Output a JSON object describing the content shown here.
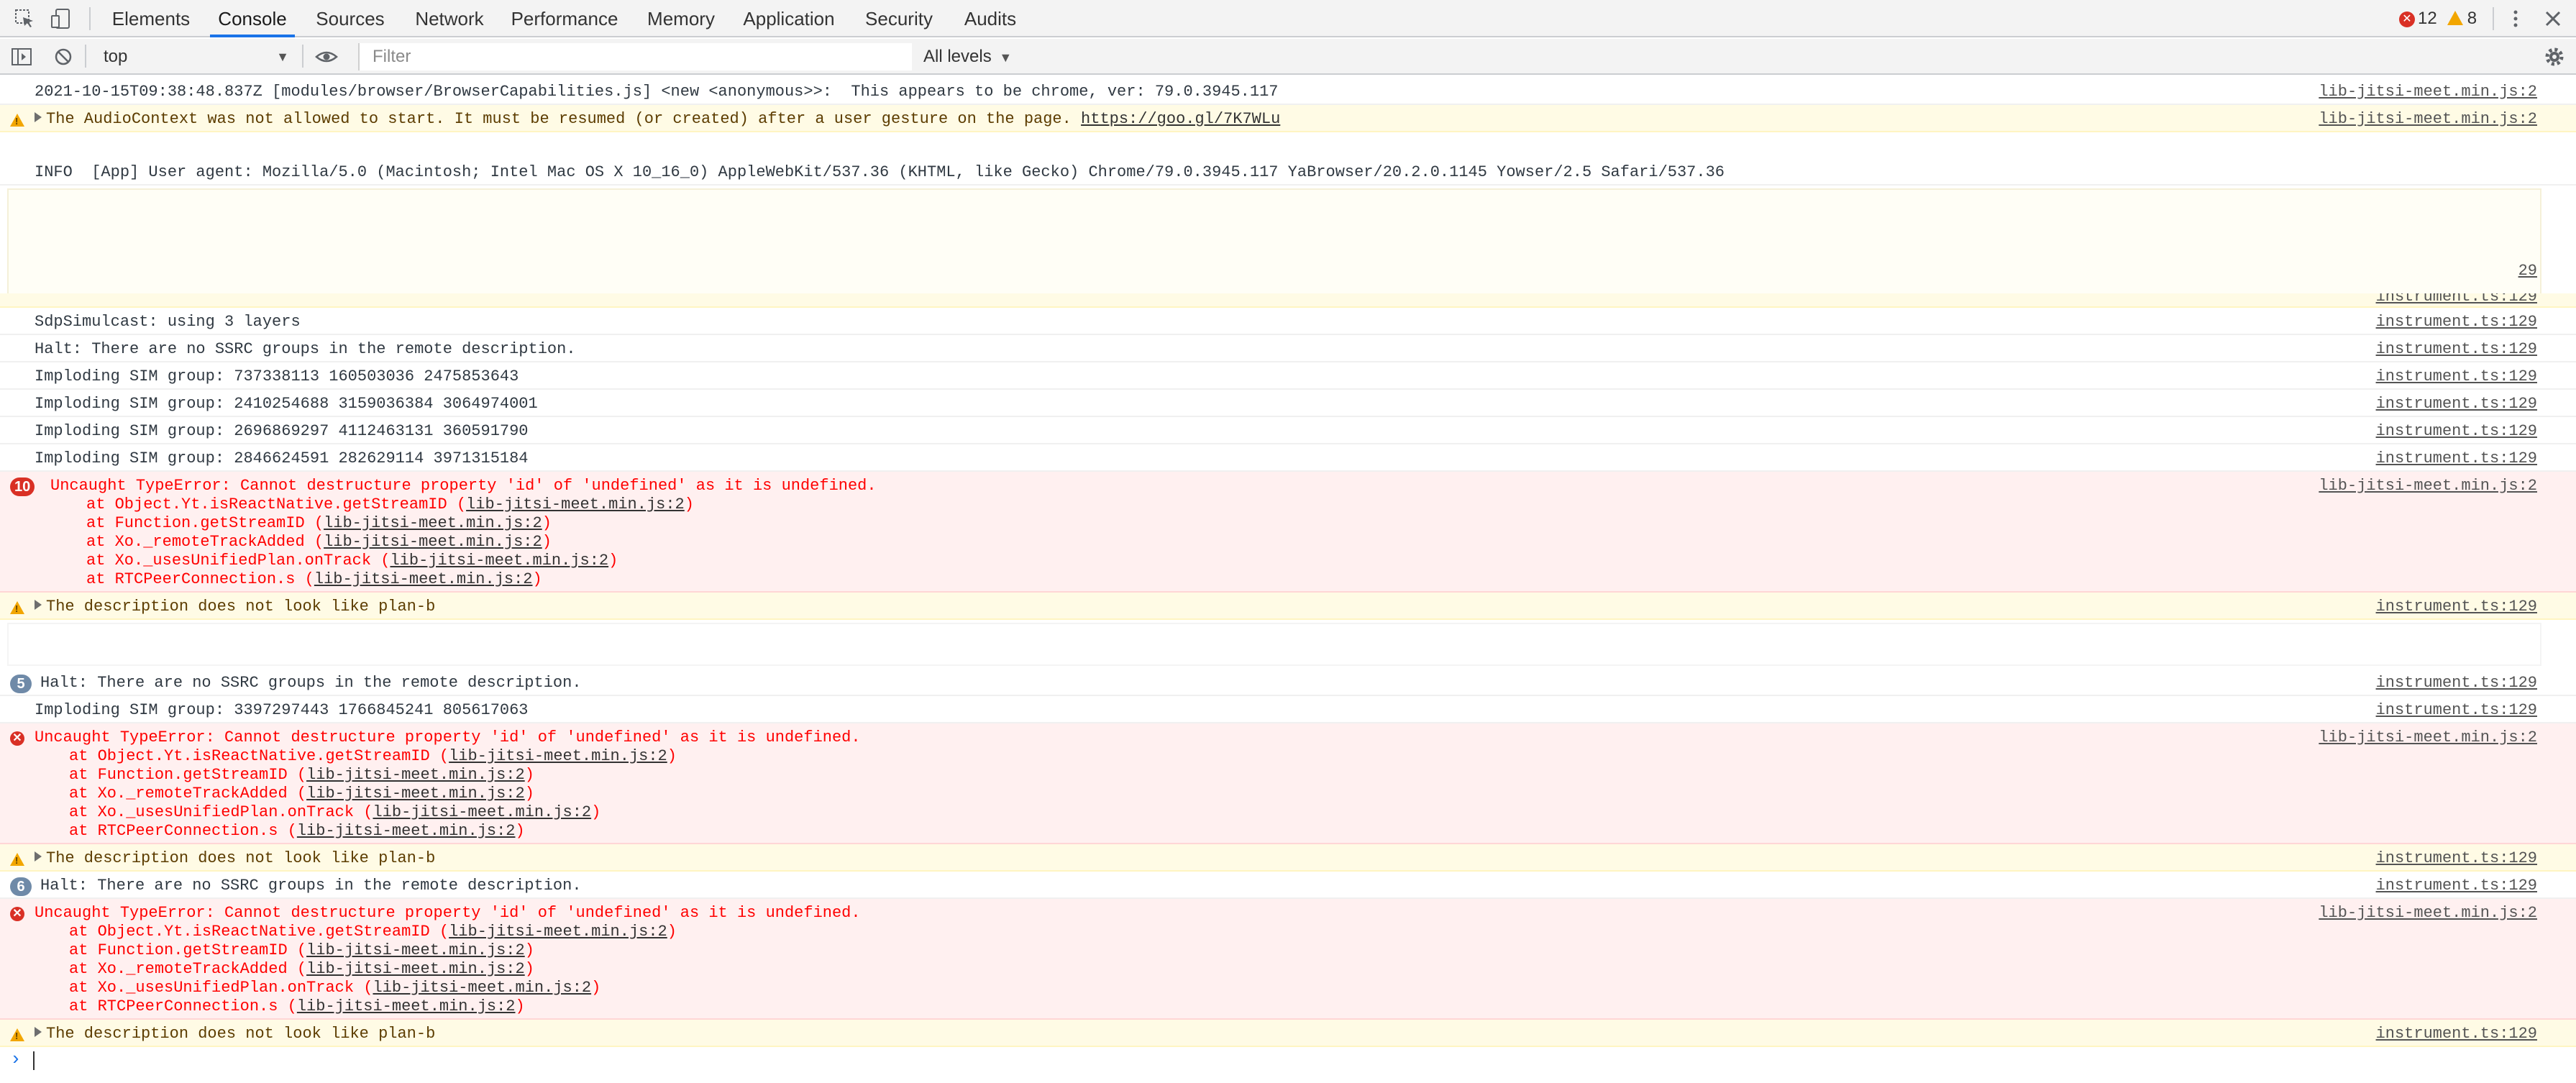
{
  "tabs": [
    {
      "label": "Elements"
    },
    {
      "label": "Console"
    },
    {
      "label": "Sources"
    },
    {
      "label": "Network"
    },
    {
      "label": "Performance"
    },
    {
      "label": "Memory"
    },
    {
      "label": "Application"
    },
    {
      "label": "Security"
    },
    {
      "label": "Audits"
    }
  ],
  "active_tab": "Console",
  "counts": {
    "errors": "12",
    "warnings": "8"
  },
  "toolbar": {
    "context": "top",
    "filter_placeholder": "Filter",
    "levels": "All levels"
  },
  "colors": {
    "error": "#d93025",
    "warning": "#f2a600",
    "accent": "#1a73e8"
  },
  "messages": {
    "m1": {
      "text": "2021-10-15T09:38:48.837Z [modules/browser/BrowserCapabilities.js] <new <anonymous>>:  This appears to be chrome, ver: 79.0.3945.117",
      "src": "lib-jitsi-meet.min.js:2"
    },
    "m2": {
      "text": "The AudioContext was not allowed to start. It must be resumed (or created) after a user gesture on the page. ",
      "link": "https://goo.gl/7K7WLu",
      "src": "lib-jitsi-meet.min.js:2"
    },
    "m3": {
      "text": "INFO  [App] User agent: Mozilla/5.0 (Macintosh; Intel Mac OS X 10_16_0) AppleWebKit/537.36 (KHTML, like Gecko) Chrome/79.0.3945.117 YaBrowser/20.2.0.1145 Yowser/2.5 Safari/537.36"
    },
    "m4": {
      "src_partial": "29"
    },
    "m5": {
      "src": "instrument.ts:129"
    },
    "m6": {
      "text": "SdpSimulcast: using 3 layers",
      "src": "instrument.ts:129"
    },
    "m7": {
      "text": "Halt: There are no SSRC groups in the remote description.",
      "src": "instrument.ts:129"
    },
    "m8": {
      "text": "Imploding SIM group: 737338113 160503036 2475853643",
      "src": "instrument.ts:129"
    },
    "m9": {
      "text": "Imploding SIM group: 2410254688 3159036384 3064974001",
      "src": "instrument.ts:129"
    },
    "m10": {
      "text": "Imploding SIM group: 2696869297 4112463131 360591790",
      "src": "instrument.ts:129"
    },
    "m11": {
      "text": "Imploding SIM group: 2846624591 282629114 3971315184",
      "src": "instrument.ts:129"
    },
    "e1": {
      "count": "10",
      "text": "Uncaught TypeError: Cannot destructure property 'id' of 'undefined' as it is undefined.",
      "src": "lib-jitsi-meet.min.js:2"
    },
    "w1": {
      "text": "The description does not look like plan-b",
      "src": "instrument.ts:129"
    },
    "m12": {
      "count": "5",
      "text": "Halt: There are no SSRC groups in the remote description.",
      "src": "instrument.ts:129"
    },
    "m13": {
      "text": "Imploding SIM group: 3397297443 1766845241 805617063",
      "src": "instrument.ts:129"
    },
    "e2": {
      "text": "Uncaught TypeError: Cannot destructure property 'id' of 'undefined' as it is undefined.",
      "src": "lib-jitsi-meet.min.js:2"
    },
    "w2": {
      "text": "The description does not look like plan-b",
      "src": "instrument.ts:129"
    },
    "m14": {
      "count": "6",
      "text": "Halt: There are no SSRC groups in the remote description.",
      "src": "instrument.ts:129"
    },
    "e3": {
      "text": "Uncaught TypeError: Cannot destructure property 'id' of 'undefined' as it is undefined.",
      "src": "lib-jitsi-meet.min.js:2"
    },
    "w3": {
      "text": "The description does not look like plan-b",
      "src": "instrument.ts:129"
    }
  },
  "stack": {
    "frames": [
      {
        "at": "at Object.Yt.isReactNative.getStreamID (",
        "file": "lib-jitsi-meet.min.js:2",
        "close": ")"
      },
      {
        "at": "at Function.getStreamID (",
        "file": "lib-jitsi-meet.min.js:2",
        "close": ")"
      },
      {
        "at": "at Xo._remoteTrackAdded (",
        "file": "lib-jitsi-meet.min.js:2",
        "close": ")"
      },
      {
        "at": "at Xo._usesUnifiedPlan.onTrack (",
        "file": "lib-jitsi-meet.min.js:2",
        "close": ")"
      },
      {
        "at": "at RTCPeerConnection.s (",
        "file": "lib-jitsi-meet.min.js:2",
        "close": ")"
      }
    ]
  },
  "prompt_symbol": "›"
}
